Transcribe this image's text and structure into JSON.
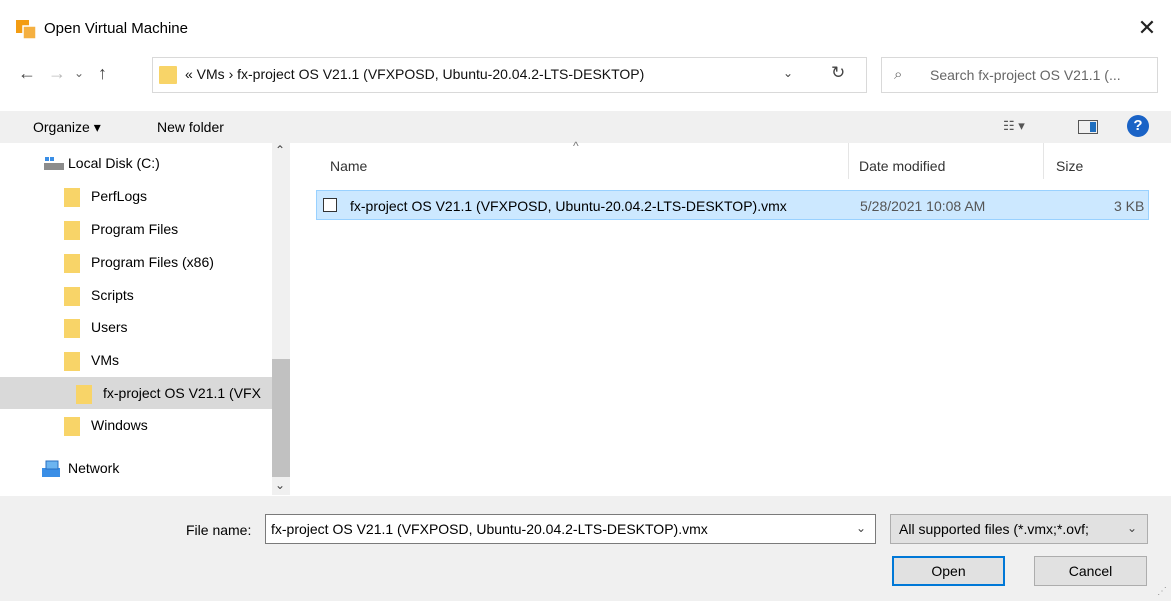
{
  "window": {
    "title": "Open Virtual Machine",
    "close_glyph": "✕"
  },
  "nav": {
    "back": "←",
    "forward": "→",
    "recent": "⌄",
    "up": "↑"
  },
  "address": {
    "path": "« VMs › fx-project OS V21.1 (VFXPOSD, Ubuntu-20.04.2-LTS-DESKTOP)",
    "dropdown": "⌄",
    "refresh": "↻"
  },
  "search": {
    "placeholder": "Search fx-project OS V21.1 (...",
    "icon": "⌕"
  },
  "toolbar": {
    "organize_label": "Organize ▾",
    "new_folder_label": "New folder",
    "view_label": "☷ ▾",
    "help_label": "?"
  },
  "sidebar": {
    "items": [
      {
        "label": "Local Disk (C:)"
      },
      {
        "label": "PerfLogs"
      },
      {
        "label": "Program Files"
      },
      {
        "label": "Program Files (x86)"
      },
      {
        "label": "Scripts"
      },
      {
        "label": "Users"
      },
      {
        "label": "VMs"
      },
      {
        "label": "fx-project OS V21.1 (VFX"
      },
      {
        "label": "Windows"
      },
      {
        "label": "Network"
      }
    ],
    "scroll_up": "⌃",
    "scroll_down": "⌄"
  },
  "filelist": {
    "columns": {
      "name": "Name",
      "date": "Date modified",
      "size": "Size",
      "sort_indicator": "^"
    },
    "rows": [
      {
        "name": "fx-project OS V21.1 (VFXPOSD, Ubuntu-20.04.2-LTS-DESKTOP).vmx",
        "date": "5/28/2021 10:08 AM",
        "size": "3 KB"
      }
    ]
  },
  "footer": {
    "file_name_label": "File name:",
    "file_name_value": "fx-project OS V21.1 (VFXPOSD, Ubuntu-20.04.2-LTS-DESKTOP).vmx",
    "file_name_dropdown": "⌄",
    "file_type": "All supported files (*.vmx;*.ovf;",
    "file_type_dropdown": "⌄",
    "open_label": "Open",
    "cancel_label": "Cancel",
    "grip": "⋰"
  }
}
